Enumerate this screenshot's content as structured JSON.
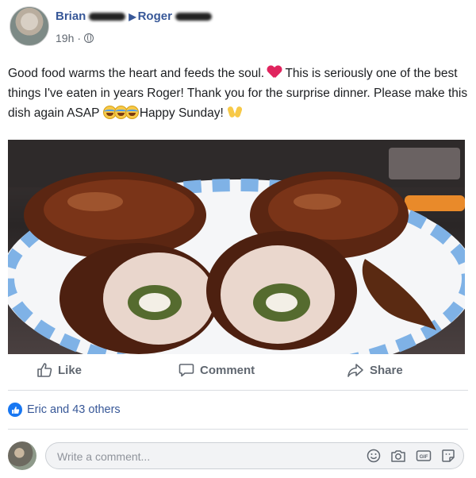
{
  "post": {
    "author": "Brian",
    "recipient": "Roger",
    "arrow_glyph": "▶",
    "time": "19h",
    "privacy_icon": "globe-icon",
    "text_segments": [
      "Good food warms the heart and feeds the soul.",
      "This is seriously one of the best things I've eaten in years Roger! Thank you for the surprise dinner. Please make this dish again ASAP",
      "Happy Sunday!"
    ],
    "photo_description_icon": "food-photo"
  },
  "actions": {
    "like": "Like",
    "comment": "Comment",
    "share": "Share"
  },
  "reactions": {
    "summary": "Eric and 43 others"
  },
  "comment": {
    "placeholder": "Write a comment..."
  },
  "colors": {
    "link_blue": "#385898",
    "like_blue": "#1877f2",
    "text_gray": "#606770"
  }
}
